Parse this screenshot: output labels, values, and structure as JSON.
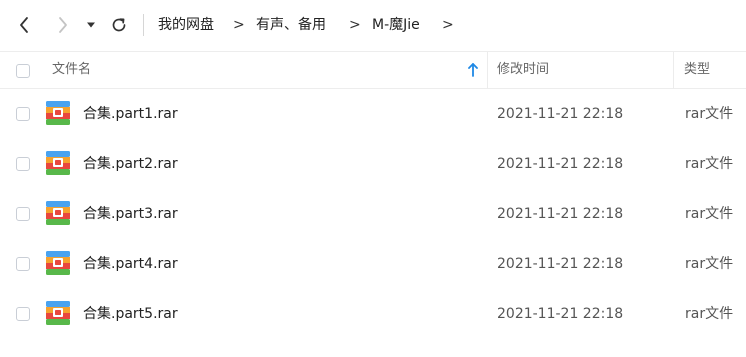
{
  "toolbar": {
    "breadcrumb": [
      {
        "label": "我的网盘"
      },
      {
        "label": "有声、备用"
      },
      {
        "label": "M-魔Jie"
      }
    ],
    "separator": ">"
  },
  "header": {
    "name_col": "文件名",
    "time_col": "修改时间",
    "type_col": "类型",
    "sort_icon": "arrow-up-icon"
  },
  "files": [
    {
      "name": "合集.part1.rar",
      "modified": "2021-11-21 22:18",
      "type": "rar文件"
    },
    {
      "name": "合集.part2.rar",
      "modified": "2021-11-21 22:18",
      "type": "rar文件"
    },
    {
      "name": "合集.part3.rar",
      "modified": "2021-11-21 22:18",
      "type": "rar文件"
    },
    {
      "name": "合集.part4.rar",
      "modified": "2021-11-21 22:18",
      "type": "rar文件"
    },
    {
      "name": "合集.part5.rar",
      "modified": "2021-11-21 22:18",
      "type": "rar文件"
    }
  ],
  "colors": {
    "accent": "#1e88e5",
    "archive_blue": "#4aa3f0",
    "archive_orange": "#f6a22e",
    "archive_red": "#e8473d",
    "archive_green": "#58b84a"
  }
}
